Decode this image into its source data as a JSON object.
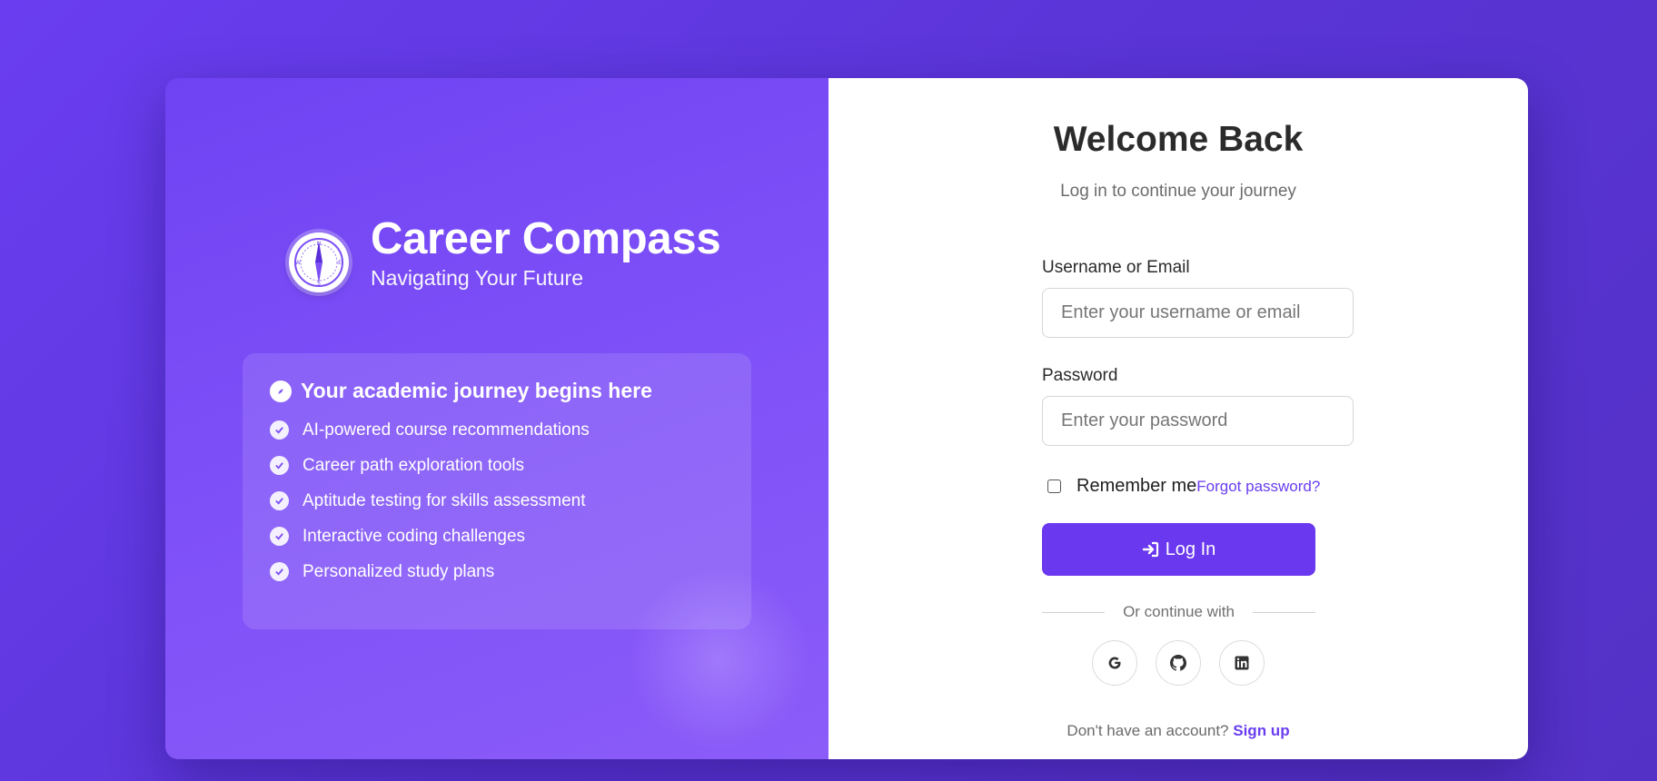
{
  "brand": {
    "title": "Career Compass",
    "subtitle": "Navigating Your Future",
    "logo_icon": "compass-icon"
  },
  "features": {
    "heading": "Your academic journey begins here",
    "heading_icon": "compass-icon",
    "items": [
      "AI-powered course recommendations",
      "Career path exploration tools",
      "Aptitude testing for skills assessment",
      "Interactive coding challenges",
      "Personalized study plans"
    ],
    "item_icon": "check-circle-icon"
  },
  "login": {
    "title": "Welcome Back",
    "subtitle": "Log in to continue your journey",
    "username_label": "Username or Email",
    "username_placeholder": "Enter your username or email",
    "password_label": "Password",
    "password_placeholder": "Enter your password",
    "remember_label": "Remember me",
    "remember_checked": false,
    "forgot_link": "Forgot password?",
    "submit_label": "Log In",
    "submit_icon": "sign-in-icon",
    "divider_text": "Or continue with",
    "social": [
      "google-icon",
      "github-icon",
      "linkedin-icon"
    ],
    "signup_prompt": "Don't have an account?",
    "signup_link": "Sign up"
  },
  "colors": {
    "accent": "#6a38ee",
    "background": "#5a34d6",
    "panel": "#7d4ff8"
  }
}
